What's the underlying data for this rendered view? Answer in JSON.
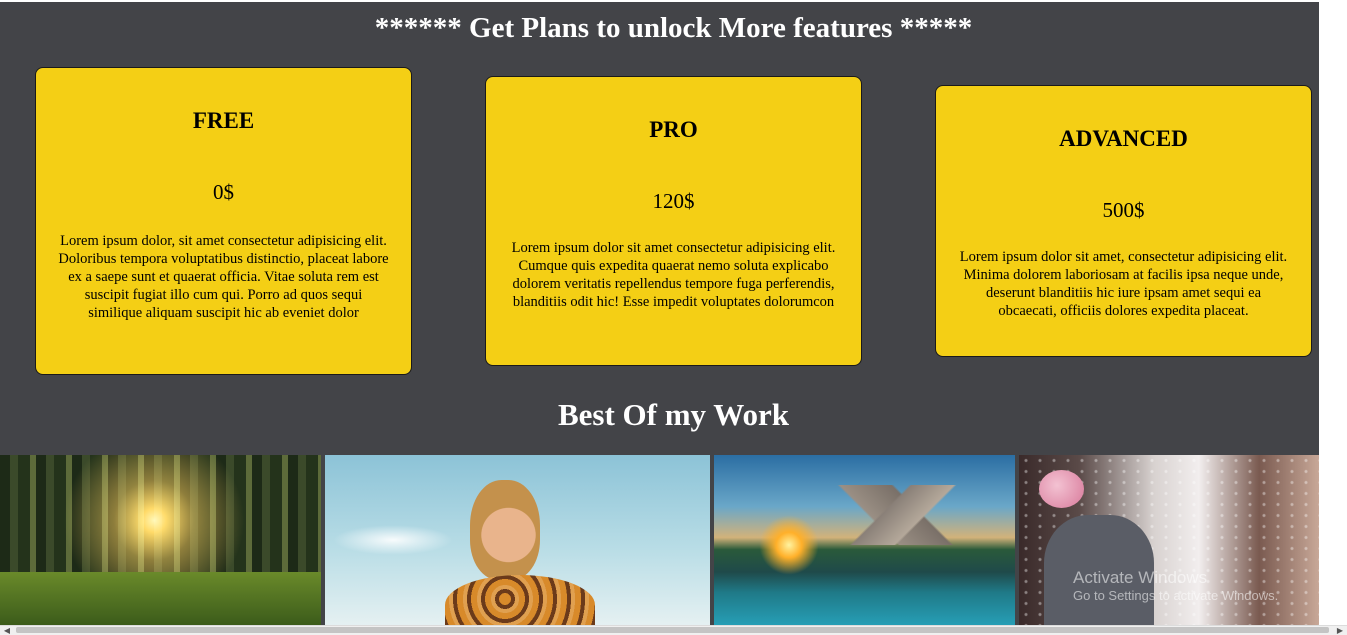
{
  "headline": "****** Get Plans to unlock More features *****",
  "plans": [
    {
      "name": "FREE",
      "price": "0$",
      "description": "Lorem ipsum dolor, sit amet consectetur adipisicing elit. Doloribus tempora voluptatibus distinctio, placeat labore ex a saepe sunt et quaerat officia. Vitae soluta rem est suscipit fugiat illo cum qui. Porro ad quos sequi similique aliquam suscipit hic ab eveniet dolor"
    },
    {
      "name": "PRO",
      "price": "120$",
      "description": "Lorem ipsum dolor sit amet consectetur adipisicing elit. Cumque quis expedita quaerat nemo soluta explicabo dolorem veritatis repellendus tempore fuga perferendis, blanditiis odit hic! Esse impedit voluptates dolorumcon"
    },
    {
      "name": "ADVANCED",
      "price": "500$",
      "description": "Lorem ipsum dolor sit amet, consectetur adipisicing elit. Minima dolorem laboriosam at facilis ipsa neque unde, deserunt blanditiis hic iure ipsam amet sequi ea obcaecati, officiis dolores expedita placeat."
    }
  ],
  "gallery": {
    "title": "Best Of my Work",
    "images": [
      "forest-photo",
      "woman-portrait-photo",
      "mountain-lake-photo",
      "wedding-couple-photo"
    ]
  },
  "watermark": {
    "line1": "Activate Windows",
    "line2": "Go to Settings to activate Windows."
  },
  "colors": {
    "background": "#434448",
    "card": "#f4cf15",
    "heading": "#ffffff"
  }
}
